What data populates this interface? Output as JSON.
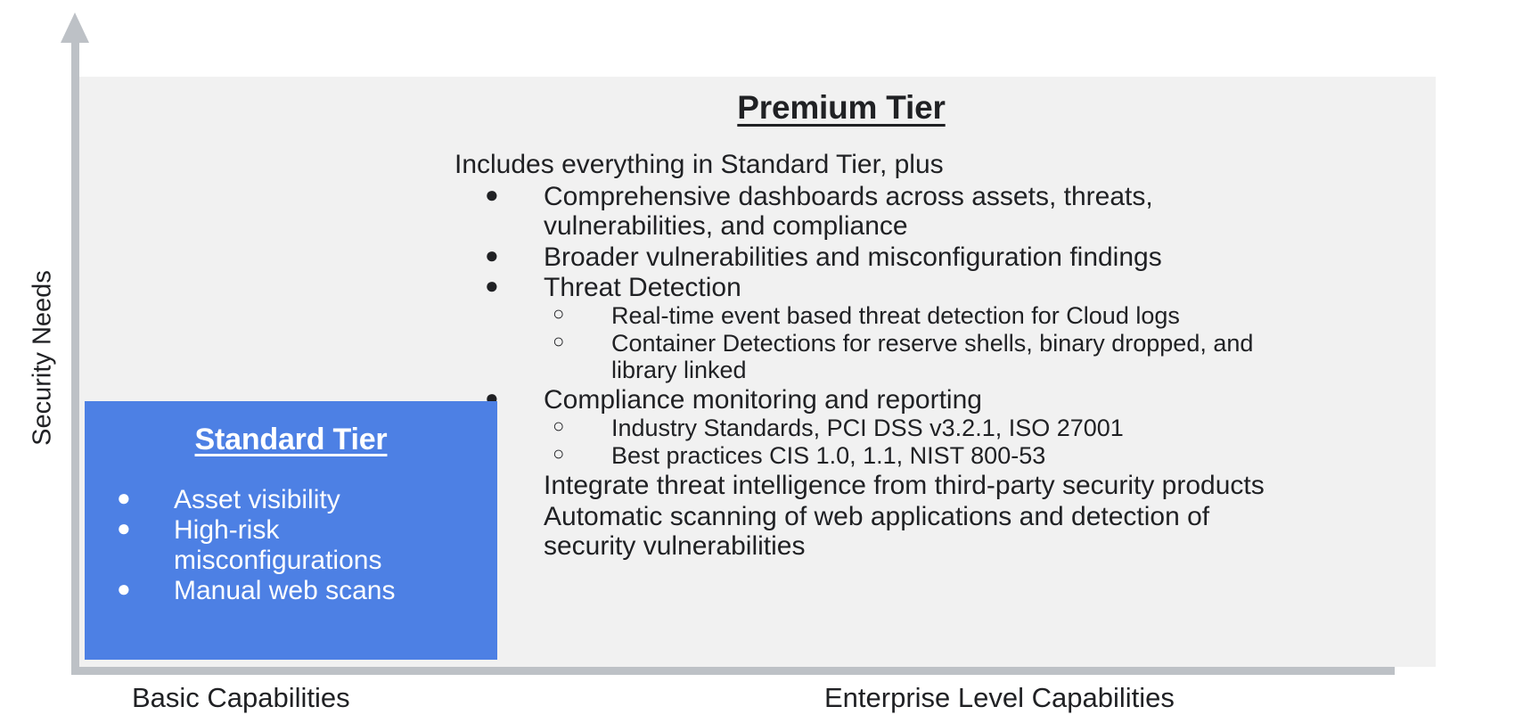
{
  "axes": {
    "y_label": "Security Needs",
    "x_label_left": "Basic Capabilities",
    "x_label_right": "Enterprise Level Capabilities",
    "y_arrow_icon": "arrow-up-icon",
    "x_axis_icon": "axis-line-icon"
  },
  "colors": {
    "standard_tier_fill": "#4d80e4",
    "premium_panel_fill": "#f1f1f1",
    "axis_gray": "#bdc1c6",
    "text_dark": "#202124",
    "text_light": "#ffffff"
  },
  "standard_tier": {
    "title": "Standard Tier",
    "bullet_mark": "●",
    "items": [
      "Asset visibility",
      "High-risk misconfigurations",
      "Manual web scans"
    ]
  },
  "premium_tier": {
    "title": "Premium Tier",
    "intro": "Includes everything in Standard Tier, plus",
    "bullet_mark_level1": "●",
    "bullet_mark_level2": "○",
    "items": [
      {
        "level": 1,
        "text": "Comprehensive dashboards across assets, threats, vulnerabilities, and compliance"
      },
      {
        "level": 1,
        "text": "Broader vulnerabilities and misconfiguration findings"
      },
      {
        "level": 1,
        "text": "Threat Detection"
      },
      {
        "level": 2,
        "text": "Real-time event based threat detection for Cloud logs"
      },
      {
        "level": 2,
        "text": "Container Detections for reserve shells, binary dropped, and library linked"
      },
      {
        "level": 1,
        "text": "Compliance monitoring and  reporting"
      },
      {
        "level": 2,
        "text": "Industry Standards, PCI DSS v3.2.1, ISO 27001"
      },
      {
        "level": 2,
        "text": "Best practices CIS 1.0, 1.1, NIST 800-53"
      },
      {
        "level": 1,
        "text": "Integrate threat intelligence from third-party security products"
      },
      {
        "level": 1,
        "text": "Automatic scanning of web applications and detection of security vulnerabilities"
      }
    ]
  }
}
